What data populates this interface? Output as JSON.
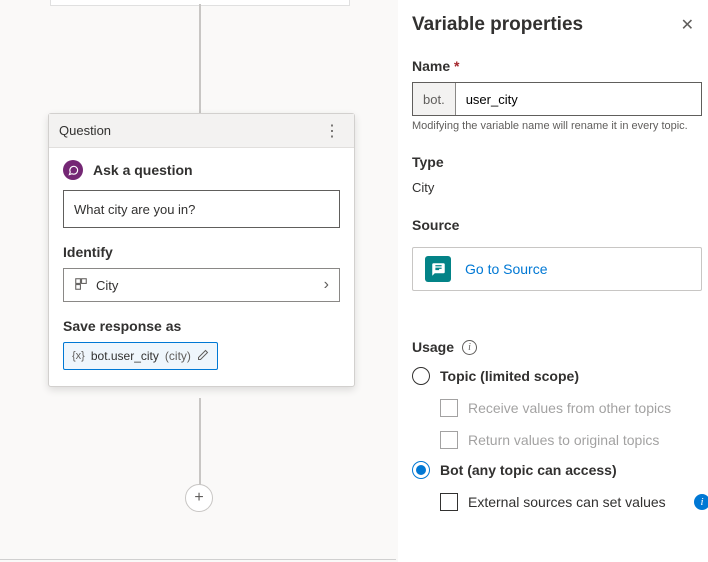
{
  "canvas": {
    "card": {
      "header": "Question",
      "askLabel": "Ask a question",
      "questionText": "What city are you in?",
      "identifyLabel": "Identify",
      "identifyValue": "City",
      "saveLabel": "Save response as",
      "chipVar": "bot.user_city",
      "chipType": "(city)",
      "chipPrefix": "{x}"
    },
    "addIcon": "+"
  },
  "panel": {
    "title": "Variable properties",
    "nameLabel": "Name",
    "namePrefix": "bot.",
    "nameValue": "user_city",
    "nameHint": "Modifying the variable name will rename it in every topic.",
    "typeLabel": "Type",
    "typeValue": "City",
    "sourceLabel": "Source",
    "sourceLink": "Go to Source",
    "usageLabel": "Usage",
    "optTopic": "Topic (limited scope)",
    "subReceive": "Receive values from other topics",
    "subReturn": "Return values to original topics",
    "optBot": "Bot (any topic can access)",
    "subExternal": "External sources can set values"
  }
}
